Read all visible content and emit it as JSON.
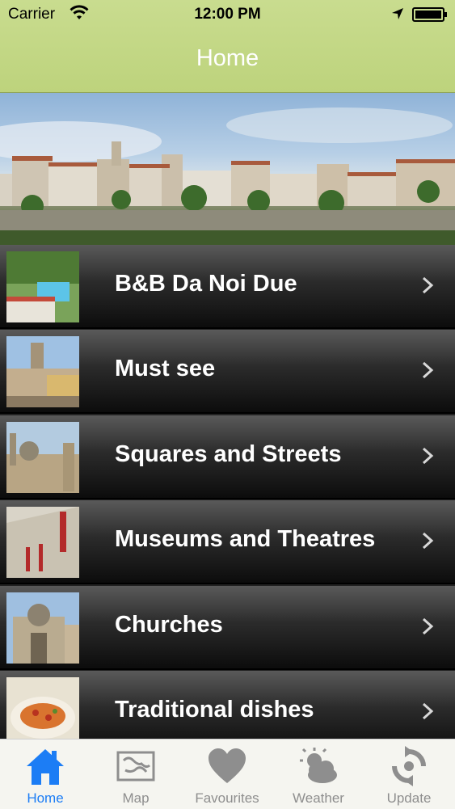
{
  "status_bar": {
    "carrier": "Carrier",
    "time": "12:00 PM"
  },
  "nav": {
    "title": "Home"
  },
  "list_items": [
    {
      "label": "B&B Da Noi Due",
      "icon": "pool-photo"
    },
    {
      "label": "Must see",
      "icon": "tower-photo"
    },
    {
      "label": "Squares and Streets",
      "icon": "square-photo"
    },
    {
      "label": "Museums and Theatres",
      "icon": "museum-photo"
    },
    {
      "label": "Churches",
      "icon": "church-photo"
    },
    {
      "label": "Traditional dishes",
      "icon": "dish-photo"
    }
  ],
  "tabs": [
    {
      "label": "Home",
      "icon": "house-icon",
      "active": true
    },
    {
      "label": "Map",
      "icon": "map-icon",
      "active": false
    },
    {
      "label": "Favourites",
      "icon": "heart-icon",
      "active": false
    },
    {
      "label": "Weather",
      "icon": "weather-icon",
      "active": false
    },
    {
      "label": "Update",
      "icon": "sync-icon",
      "active": false
    }
  ],
  "colors": {
    "nav_green": "#bdd37c",
    "tab_active": "#1c7df5",
    "tab_inactive": "#8e8e8e"
  }
}
